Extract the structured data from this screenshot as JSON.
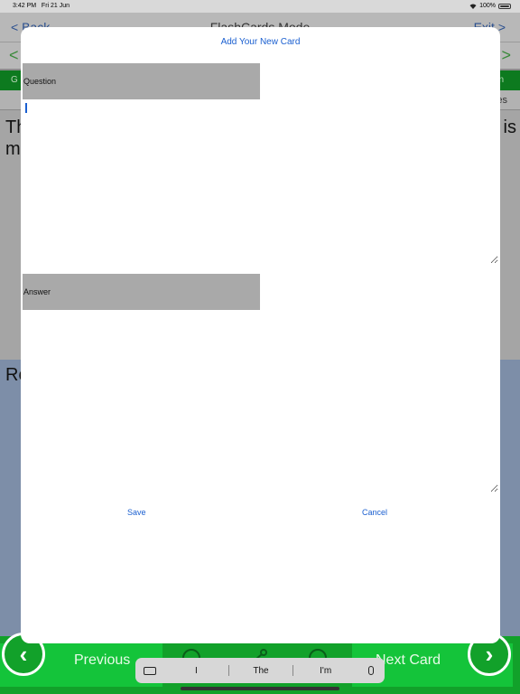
{
  "status_bar": {
    "time": "3:42 PM",
    "date": "Fri 21 Jun",
    "battery": "100%"
  },
  "background": {
    "nav": {
      "back": "< Back",
      "title": "FlashCards Mode",
      "exit": "Exit >"
    },
    "arrows": {
      "left": "<",
      "right": ">"
    },
    "green_row": {
      "left": "G",
      "right": "n"
    },
    "tabs_row": {
      "right": "es"
    },
    "question_text": {
      "line1": "Th",
      "line2": "m",
      "tail": "is"
    },
    "answer_text": {
      "line1": "Re"
    },
    "bottom": {
      "previous": "Previous",
      "next": "Next Card",
      "prev_arrow": "‹",
      "next_arrow": "›"
    }
  },
  "modal": {
    "title": "Add Your New Card",
    "question_label": "Question",
    "question_value": "",
    "answer_label": "Answer",
    "answer_value": "",
    "save": "Save",
    "cancel": "Cancel"
  },
  "keyboard": {
    "suggestions": [
      "I",
      "The",
      "I'm"
    ]
  },
  "colors": {
    "accent": "#1a5fd0",
    "green": "#14c43a",
    "label_bg": "#a9a9a9"
  }
}
